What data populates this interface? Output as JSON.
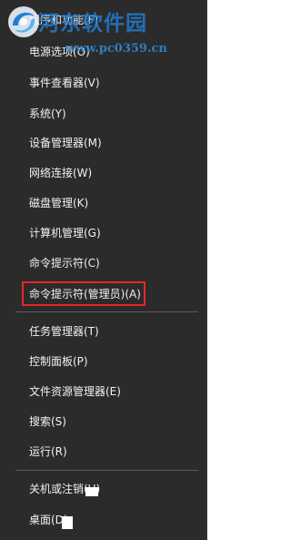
{
  "menu": {
    "items": [
      {
        "label": "程序和功能(F)"
      },
      {
        "label": "电源选项(O)"
      },
      {
        "label": "事件查看器(V)"
      },
      {
        "label": "系统(Y)"
      },
      {
        "label": "设备管理器(M)"
      },
      {
        "label": "网络连接(W)"
      },
      {
        "label": "磁盘管理(K)"
      },
      {
        "label": "计算机管理(G)"
      },
      {
        "label": "命令提示符(C)"
      },
      {
        "label": "命令提示符(管理员)(A)"
      },
      {
        "label": "任务管理器(T)"
      },
      {
        "label": "控制面板(P)"
      },
      {
        "label": "文件资源管理器(E)"
      },
      {
        "label": "搜索(S)"
      },
      {
        "label": "运行(R)"
      },
      {
        "label": "关机或注销(U)"
      },
      {
        "label": "桌面(D)"
      }
    ],
    "highlighted_item": "命令提示符(管理员)(A)",
    "highlight_color": "#e8262b",
    "background_color": "#2b2b2b"
  },
  "watermark": {
    "title": "河东软件园",
    "url": "www.pc0359.cn",
    "icon": "swirl-logo-icon",
    "color": "#1f7fd6"
  }
}
